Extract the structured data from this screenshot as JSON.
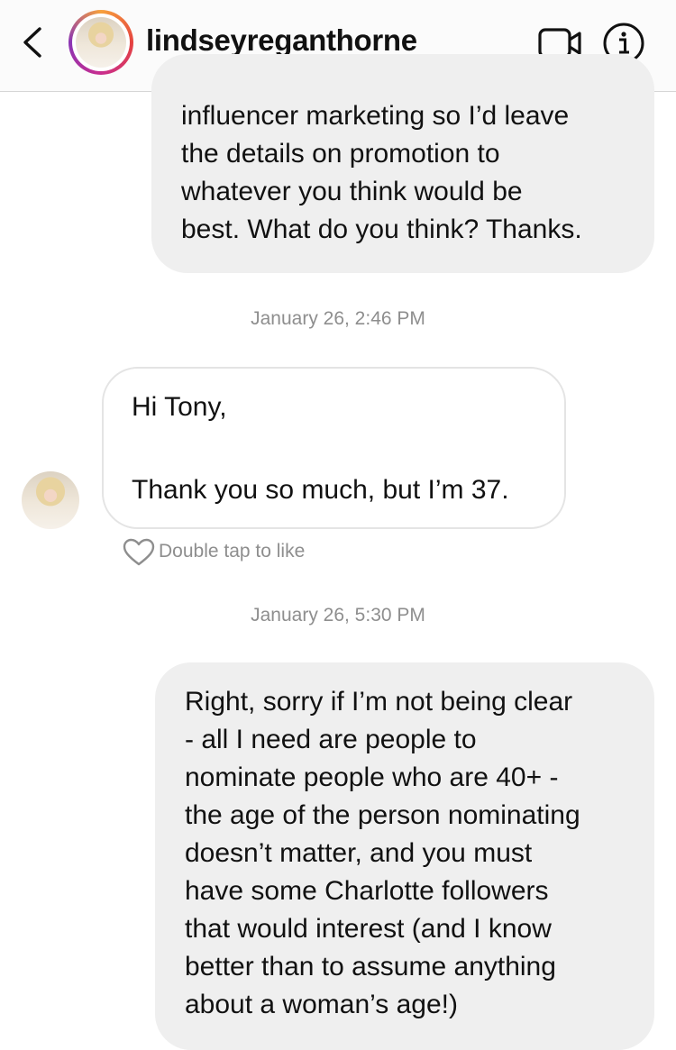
{
  "header": {
    "username": "lindseyreganthorne",
    "back_icon": "chevron-left-icon",
    "video_icon": "video-camera-icon",
    "info_icon": "info-icon"
  },
  "messages": [
    {
      "type": "sent",
      "lines": [
        "influencer marketing so I’d leave",
        "the details on promotion to",
        "whatever you think would be",
        "best. What do you think? Thanks."
      ]
    },
    {
      "type": "timestamp",
      "text": "January 26, 2:46 PM"
    },
    {
      "type": "received",
      "lines": [
        "Hi Tony,",
        "",
        "Thank you so much, but I’m 37."
      ],
      "like_hint": "Double tap to like"
    },
    {
      "type": "timestamp",
      "text": "January 26, 5:30 PM"
    },
    {
      "type": "sent",
      "lines": [
        "Right, sorry if I’m not being clear",
        "- all I need are people to",
        "nominate people who are 40+ -",
        "the age of the person nominating",
        "doesn’t matter, and you must",
        "have some Charlotte followers",
        "that would interest (and I know",
        "better than to assume anything",
        "about a woman’s age!)"
      ]
    }
  ],
  "colors": {
    "sent_bubble": "#efefef",
    "received_border": "#e4e4e4",
    "meta_text": "#8e8e8e"
  }
}
